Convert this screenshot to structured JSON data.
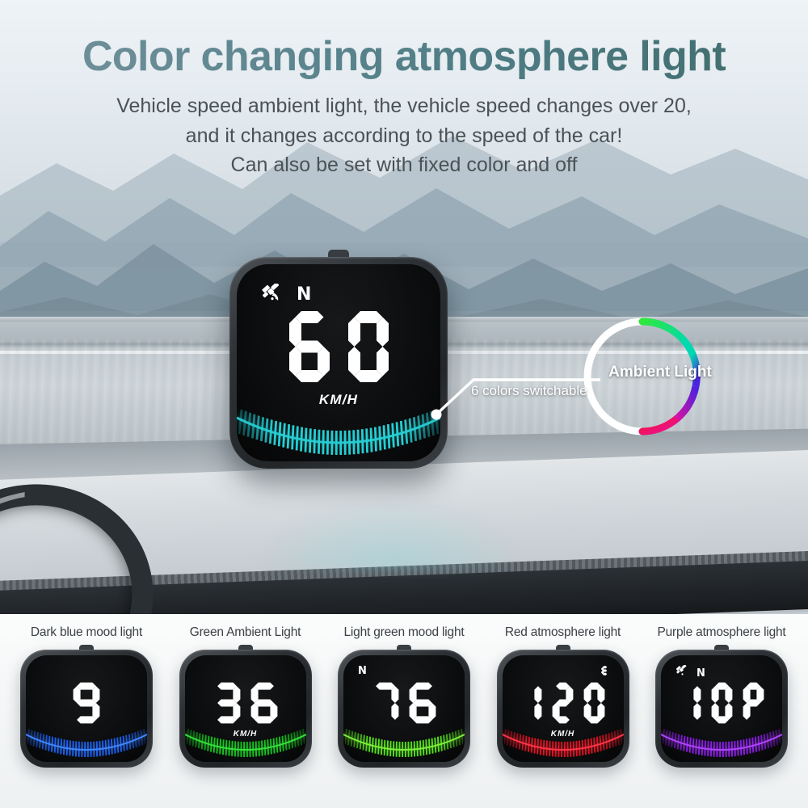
{
  "header": {
    "title": "Color changing atmosphere light",
    "subtitle_line1": "Vehicle speed ambient light, the vehicle speed changes over 20,",
    "subtitle_line2": "and it changes according to the speed of the car!",
    "subtitle_line3": "Can also be set with fixed color and off",
    "title_color_start": "#74929b",
    "title_color_end": "#3f6b6a",
    "subtitle_color": "#4a5257"
  },
  "main_device": {
    "speed": "60",
    "unit": "KM/H",
    "gear_indicator": "N",
    "satellite_icon": "satellite-icon",
    "led_color": "#26cfd4",
    "screen_color": "#0a0b0c"
  },
  "callout": {
    "ring_label": "Ambient Light",
    "line_label": "6 colors switchable",
    "ring_left_color": "#ffffff",
    "ring_gradient": [
      "#2ee83c",
      "#00d9b0",
      "#0b8cf0",
      "#4a22e0",
      "#9b17d8",
      "#e8119b",
      "#f5133f"
    ]
  },
  "variants": [
    {
      "label": "Dark blue mood light",
      "speed": "9",
      "unit": "",
      "gear_indicator": "",
      "satellite_icon": false,
      "led_color": "#1a5ef0",
      "led_glow": "#3f86ff"
    },
    {
      "label": "Green Ambient Light",
      "speed": "36",
      "unit": "KM/H",
      "gear_indicator": "",
      "satellite_icon": false,
      "led_color": "#13c21c",
      "led_glow": "#35e03c"
    },
    {
      "label": "Light green mood light",
      "speed": "76",
      "unit": "",
      "gear_indicator": "N",
      "satellite_icon": false,
      "led_color": "#52e019",
      "led_glow": "#7cf03c"
    },
    {
      "label": "Red atmosphere light",
      "speed": "120",
      "unit": "KM/H",
      "gear_indicator": "E",
      "satellite_icon": false,
      "led_color": "#e01020",
      "led_glow": "#ff3545"
    },
    {
      "label": "Purple atmosphere light",
      "speed": "10P",
      "unit": "",
      "gear_indicator": "N",
      "satellite_icon": true,
      "led_color": "#8a1ae8",
      "led_glow": "#b044ff"
    }
  ]
}
